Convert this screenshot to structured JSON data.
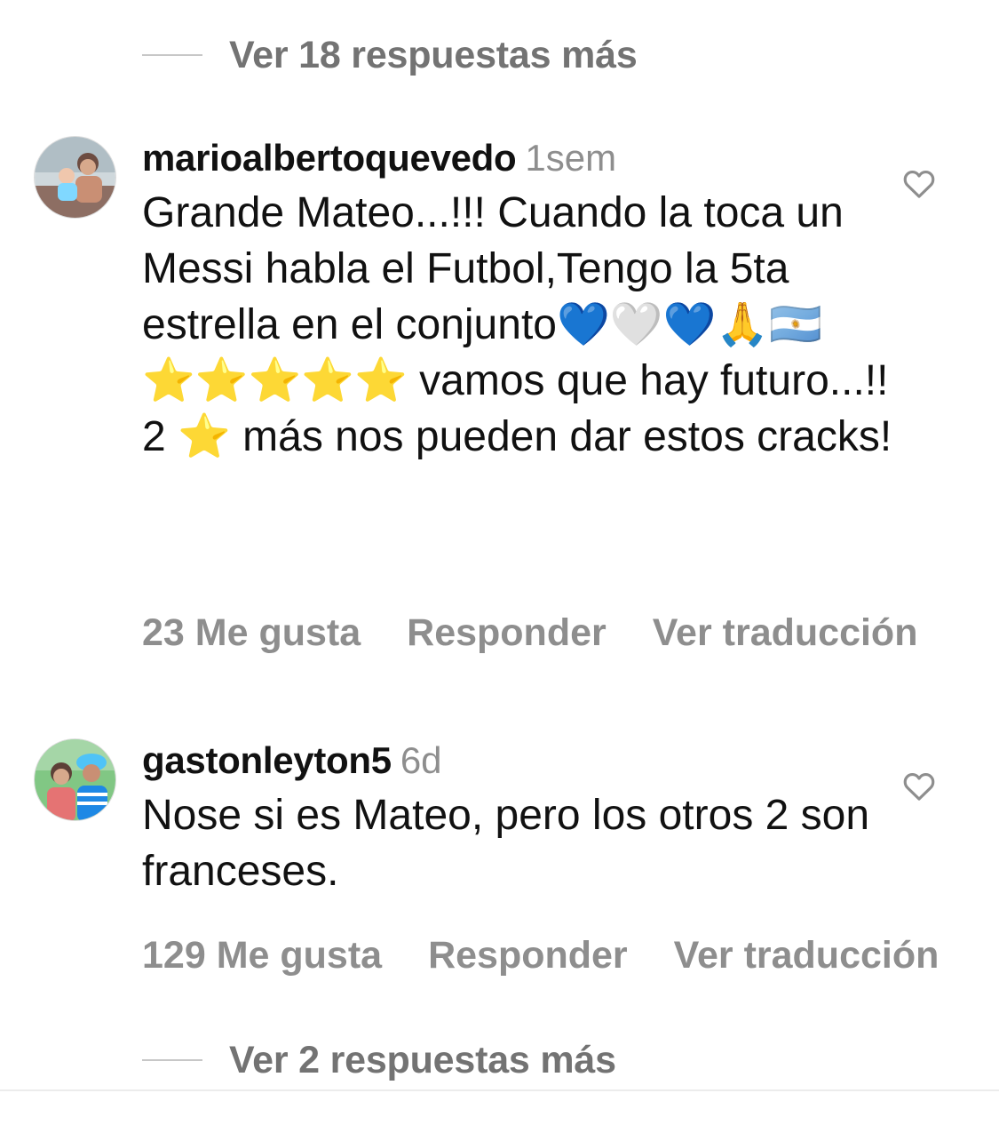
{
  "top_view_replies": {
    "label": "Ver 18 respuestas más"
  },
  "comments": [
    {
      "username": "marioalbertoquevedo",
      "time": "1sem",
      "text": "Grande Mateo...!!! Cuando la toca un Messi habla el Futbol,Tengo la 5ta estrella en el conjunto💙🤍💙🙏🇦🇷 ⭐️⭐️⭐️⭐️⭐️ vamos que hay futuro...!! 2 ⭐️ más nos pueden dar estos cracks!",
      "likes": "23 Me gusta",
      "reply": "Responder",
      "translate": "Ver traducción"
    },
    {
      "username": "gastonleyton5",
      "time": "6d",
      "text": "Nose si es Mateo, pero los otros 2 son franceses.",
      "likes": "129 Me gusta",
      "reply": "Responder",
      "translate": "Ver traducción"
    }
  ],
  "bottom_view_replies": {
    "label": "Ver 2 respuestas más"
  },
  "icons": {
    "like": "heart-outline-icon"
  },
  "colors": {
    "secondary_text": "#8e8e8e",
    "primary_text": "#111111"
  }
}
